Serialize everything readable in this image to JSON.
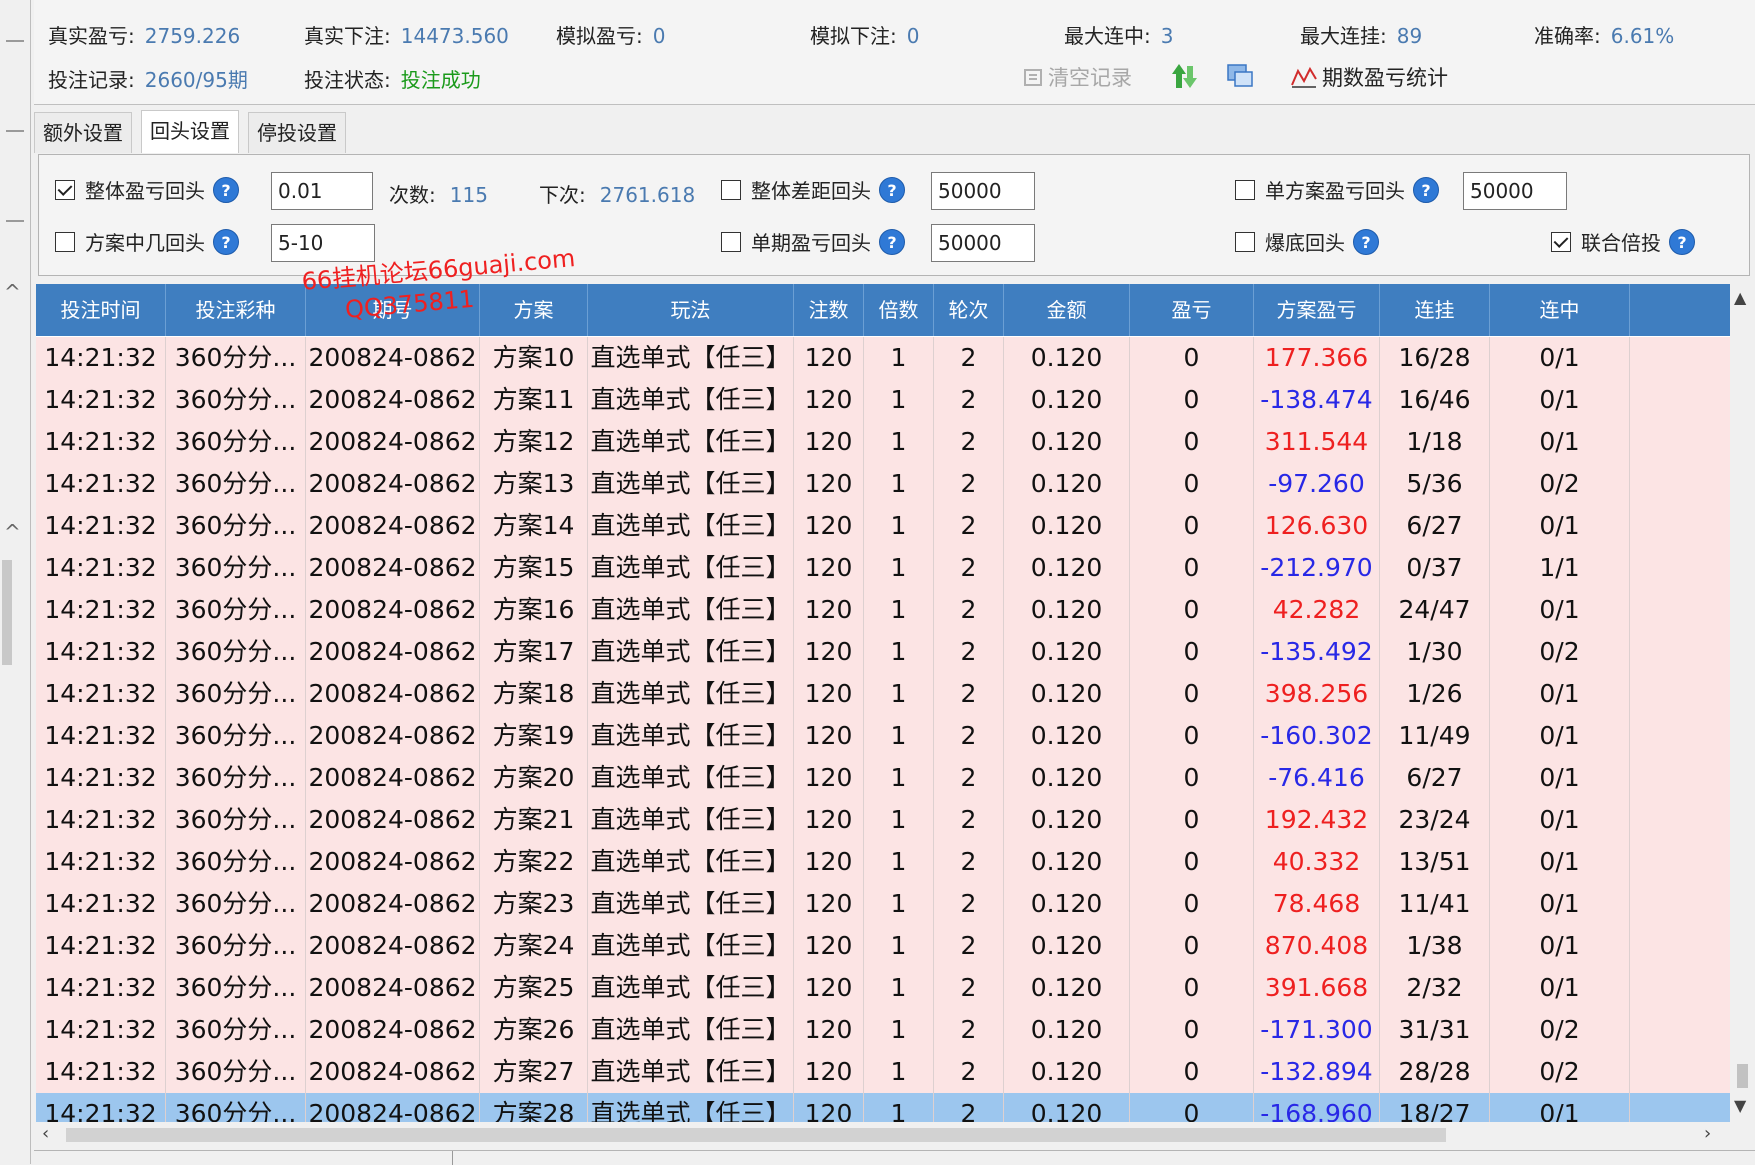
{
  "stats": {
    "real_pl_label": "真实盈亏:",
    "real_pl_value": "2759.226",
    "real_bet_label": "真实下注:",
    "real_bet_value": "14473.560",
    "sim_pl_label": "模拟盈亏:",
    "sim_pl_value": "0",
    "sim_bet_label": "模拟下注:",
    "sim_bet_value": "0",
    "max_win_streak_label": "最大连中:",
    "max_win_streak_value": "3",
    "max_loss_streak_label": "最大连挂:",
    "max_loss_streak_value": "89",
    "accuracy_label": "准确率:",
    "accuracy_value": "6.61%",
    "record_label": "投注记录:",
    "record_value": "2660/95期",
    "status_label": "投注状态:",
    "status_value": "投注成功"
  },
  "toolbar": {
    "clear_label": "清空记录",
    "stats_label": "期数盈亏统计"
  },
  "tabs": [
    {
      "label": "额外设置"
    },
    {
      "label": "回头设置"
    },
    {
      "label": "停投设置"
    }
  ],
  "settings": {
    "overall_pl_label": "整体盈亏回头",
    "overall_pl_value": "0.01",
    "count_label": "次数:",
    "count_value": "115",
    "next_label": "下次:",
    "next_value": "2761.618",
    "overall_diff_label": "整体差距回头",
    "overall_diff_value": "50000",
    "single_plan_label": "单方案盈亏回头",
    "single_plan_value": "50000",
    "plan_hit_label": "方案中几回头",
    "plan_hit_value": "5-10",
    "single_period_label": "单期盈亏回头",
    "single_period_value": "50000",
    "bust_label": "爆底回头",
    "joint_label": "联合倍投",
    "help_glyph": "?"
  },
  "watermark": {
    "line1": "66挂机论坛66guaji.com",
    "line2": "QQ375811"
  },
  "table": {
    "headers": [
      "投注时间",
      "投注彩种",
      "期号",
      "方案",
      "玩法",
      "注数",
      "倍数",
      "轮次",
      "金额",
      "盈亏",
      "方案盈亏",
      "连挂",
      "连中"
    ],
    "rows": [
      {
        "time": "14:21:32",
        "lottery": "360分分...",
        "period": "200824-0862",
        "plan": "方案10",
        "play": "直选单式【任三】",
        "notes": "120",
        "mult": "1",
        "round": "2",
        "amount": "0.120",
        "pl": "0",
        "plan_pl": "177.366",
        "loss": "16/28",
        "win": "0/1"
      },
      {
        "time": "14:21:32",
        "lottery": "360分分...",
        "period": "200824-0862",
        "plan": "方案11",
        "play": "直选单式【任三】",
        "notes": "120",
        "mult": "1",
        "round": "2",
        "amount": "0.120",
        "pl": "0",
        "plan_pl": "-138.474",
        "loss": "16/46",
        "win": "0/1"
      },
      {
        "time": "14:21:32",
        "lottery": "360分分...",
        "period": "200824-0862",
        "plan": "方案12",
        "play": "直选单式【任三】",
        "notes": "120",
        "mult": "1",
        "round": "2",
        "amount": "0.120",
        "pl": "0",
        "plan_pl": "311.544",
        "loss": "1/18",
        "win": "0/1"
      },
      {
        "time": "14:21:32",
        "lottery": "360分分...",
        "period": "200824-0862",
        "plan": "方案13",
        "play": "直选单式【任三】",
        "notes": "120",
        "mult": "1",
        "round": "2",
        "amount": "0.120",
        "pl": "0",
        "plan_pl": "-97.260",
        "loss": "5/36",
        "win": "0/2"
      },
      {
        "time": "14:21:32",
        "lottery": "360分分...",
        "period": "200824-0862",
        "plan": "方案14",
        "play": "直选单式【任三】",
        "notes": "120",
        "mult": "1",
        "round": "2",
        "amount": "0.120",
        "pl": "0",
        "plan_pl": "126.630",
        "loss": "6/27",
        "win": "0/1"
      },
      {
        "time": "14:21:32",
        "lottery": "360分分...",
        "period": "200824-0862",
        "plan": "方案15",
        "play": "直选单式【任三】",
        "notes": "120",
        "mult": "1",
        "round": "2",
        "amount": "0.120",
        "pl": "0",
        "plan_pl": "-212.970",
        "loss": "0/37",
        "win": "1/1"
      },
      {
        "time": "14:21:32",
        "lottery": "360分分...",
        "period": "200824-0862",
        "plan": "方案16",
        "play": "直选单式【任三】",
        "notes": "120",
        "mult": "1",
        "round": "2",
        "amount": "0.120",
        "pl": "0",
        "plan_pl": "42.282",
        "loss": "24/47",
        "win": "0/1"
      },
      {
        "time": "14:21:32",
        "lottery": "360分分...",
        "period": "200824-0862",
        "plan": "方案17",
        "play": "直选单式【任三】",
        "notes": "120",
        "mult": "1",
        "round": "2",
        "amount": "0.120",
        "pl": "0",
        "plan_pl": "-135.492",
        "loss": "1/30",
        "win": "0/2"
      },
      {
        "time": "14:21:32",
        "lottery": "360分分...",
        "period": "200824-0862",
        "plan": "方案18",
        "play": "直选单式【任三】",
        "notes": "120",
        "mult": "1",
        "round": "2",
        "amount": "0.120",
        "pl": "0",
        "plan_pl": "398.256",
        "loss": "1/26",
        "win": "0/1"
      },
      {
        "time": "14:21:32",
        "lottery": "360分分...",
        "period": "200824-0862",
        "plan": "方案19",
        "play": "直选单式【任三】",
        "notes": "120",
        "mult": "1",
        "round": "2",
        "amount": "0.120",
        "pl": "0",
        "plan_pl": "-160.302",
        "loss": "11/49",
        "win": "0/1"
      },
      {
        "time": "14:21:32",
        "lottery": "360分分...",
        "period": "200824-0862",
        "plan": "方案20",
        "play": "直选单式【任三】",
        "notes": "120",
        "mult": "1",
        "round": "2",
        "amount": "0.120",
        "pl": "0",
        "plan_pl": "-76.416",
        "loss": "6/27",
        "win": "0/1"
      },
      {
        "time": "14:21:32",
        "lottery": "360分分...",
        "period": "200824-0862",
        "plan": "方案21",
        "play": "直选单式【任三】",
        "notes": "120",
        "mult": "1",
        "round": "2",
        "amount": "0.120",
        "pl": "0",
        "plan_pl": "192.432",
        "loss": "23/24",
        "win": "0/1"
      },
      {
        "time": "14:21:32",
        "lottery": "360分分...",
        "period": "200824-0862",
        "plan": "方案22",
        "play": "直选单式【任三】",
        "notes": "120",
        "mult": "1",
        "round": "2",
        "amount": "0.120",
        "pl": "0",
        "plan_pl": "40.332",
        "loss": "13/51",
        "win": "0/1"
      },
      {
        "time": "14:21:32",
        "lottery": "360分分...",
        "period": "200824-0862",
        "plan": "方案23",
        "play": "直选单式【任三】",
        "notes": "120",
        "mult": "1",
        "round": "2",
        "amount": "0.120",
        "pl": "0",
        "plan_pl": "78.468",
        "loss": "11/41",
        "win": "0/1"
      },
      {
        "time": "14:21:32",
        "lottery": "360分分...",
        "period": "200824-0862",
        "plan": "方案24",
        "play": "直选单式【任三】",
        "notes": "120",
        "mult": "1",
        "round": "2",
        "amount": "0.120",
        "pl": "0",
        "plan_pl": "870.408",
        "loss": "1/38",
        "win": "0/1"
      },
      {
        "time": "14:21:32",
        "lottery": "360分分...",
        "period": "200824-0862",
        "plan": "方案25",
        "play": "直选单式【任三】",
        "notes": "120",
        "mult": "1",
        "round": "2",
        "amount": "0.120",
        "pl": "0",
        "plan_pl": "391.668",
        "loss": "2/32",
        "win": "0/1"
      },
      {
        "time": "14:21:32",
        "lottery": "360分分...",
        "period": "200824-0862",
        "plan": "方案26",
        "play": "直选单式【任三】",
        "notes": "120",
        "mult": "1",
        "round": "2",
        "amount": "0.120",
        "pl": "0",
        "plan_pl": "-171.300",
        "loss": "31/31",
        "win": "0/2"
      },
      {
        "time": "14:21:32",
        "lottery": "360分分...",
        "period": "200824-0862",
        "plan": "方案27",
        "play": "直选单式【任三】",
        "notes": "120",
        "mult": "1",
        "round": "2",
        "amount": "0.120",
        "pl": "0",
        "plan_pl": "-132.894",
        "loss": "28/28",
        "win": "0/2"
      },
      {
        "time": "14:21:32",
        "lottery": "360分分...",
        "period": "200824-0862",
        "plan": "方案28",
        "play": "直选单式【任三】",
        "notes": "120",
        "mult": "1",
        "round": "2",
        "amount": "0.120",
        "pl": "0",
        "plan_pl": "-168.960",
        "loss": "18/27",
        "win": "0/1"
      }
    ]
  },
  "colors": {
    "header_bg": "#3f7ec0",
    "row_bg": "#fce4e4",
    "selected_row_bg": "#9cc6ee",
    "positive": "#ee2020",
    "negative": "#2828e6",
    "value_blue": "#4a7ab0",
    "status_green": "#1a9a1a"
  }
}
